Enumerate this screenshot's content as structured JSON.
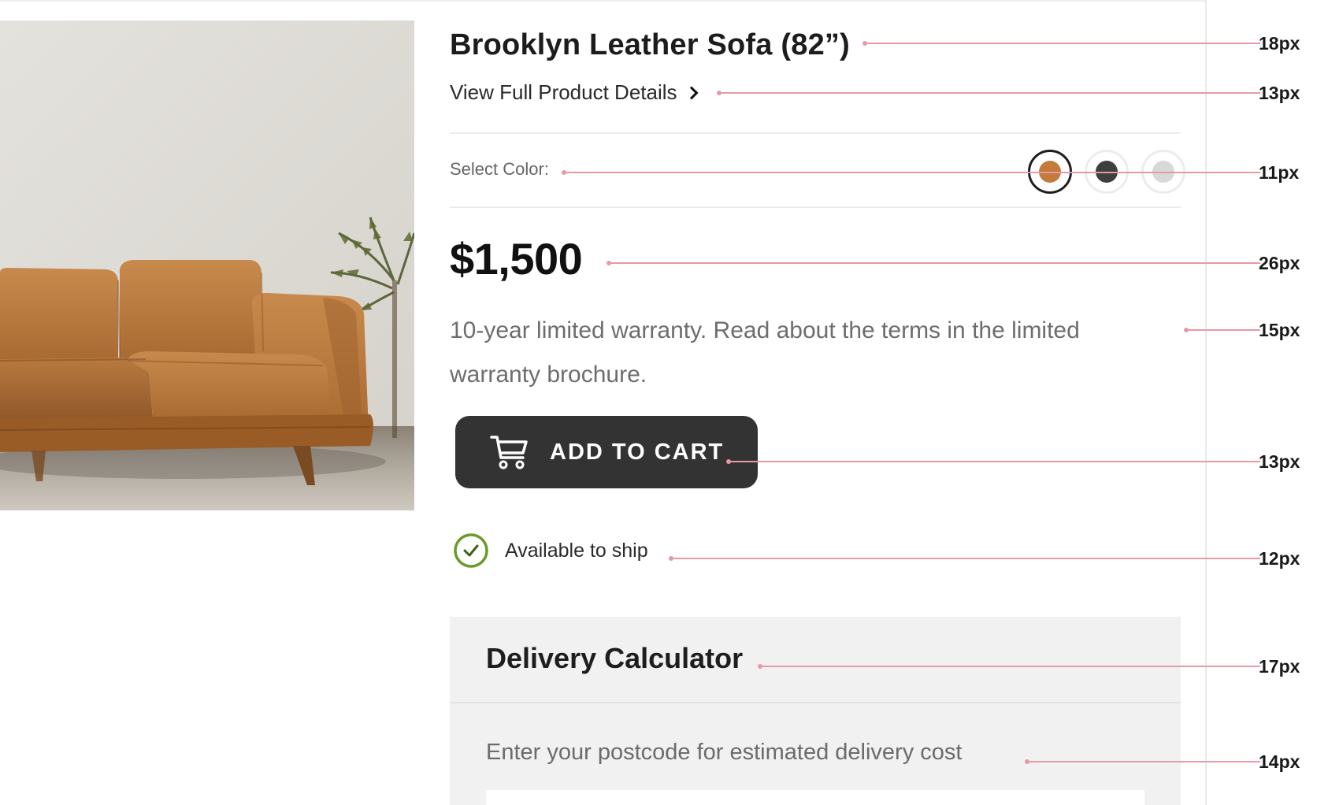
{
  "product": {
    "image_alt": "Brown leather sofa next to a palm plant",
    "title": "Brooklyn Leather Sofa (82”)",
    "details_link": "View Full Product Details",
    "color_label": "Select Color:",
    "colors": [
      {
        "name": "tan-leather",
        "hex": "#c47a3a",
        "selected": true
      },
      {
        "name": "charcoal",
        "hex": "#3f3f3f",
        "selected": false
      },
      {
        "name": "light-grey",
        "hex": "#d8d8d8",
        "selected": false
      }
    ],
    "price": "$1,500",
    "warranty": "10-year limited warranty. Read about the terms in the limited warranty brochure.",
    "add_to_cart": "ADD TO CART",
    "availability": "Available to ship"
  },
  "delivery": {
    "title": "Delivery Calculator",
    "hint": "Enter your postcode for estimated delivery cost"
  },
  "annotations": [
    {
      "target": "title",
      "size": "18px"
    },
    {
      "target": "details-link",
      "size": "13px"
    },
    {
      "target": "color-label",
      "size": "11px"
    },
    {
      "target": "price",
      "size": "26px"
    },
    {
      "target": "warranty",
      "size": "15px"
    },
    {
      "target": "add-to-cart",
      "size": "13px"
    },
    {
      "target": "availability",
      "size": "12px"
    },
    {
      "target": "delivery-title",
      "size": "17px"
    },
    {
      "target": "delivery-hint",
      "size": "14px"
    }
  ],
  "colors": {
    "accent_dark": "#333333",
    "success": "#6a9a2a",
    "annotation": "#e59aa6"
  }
}
